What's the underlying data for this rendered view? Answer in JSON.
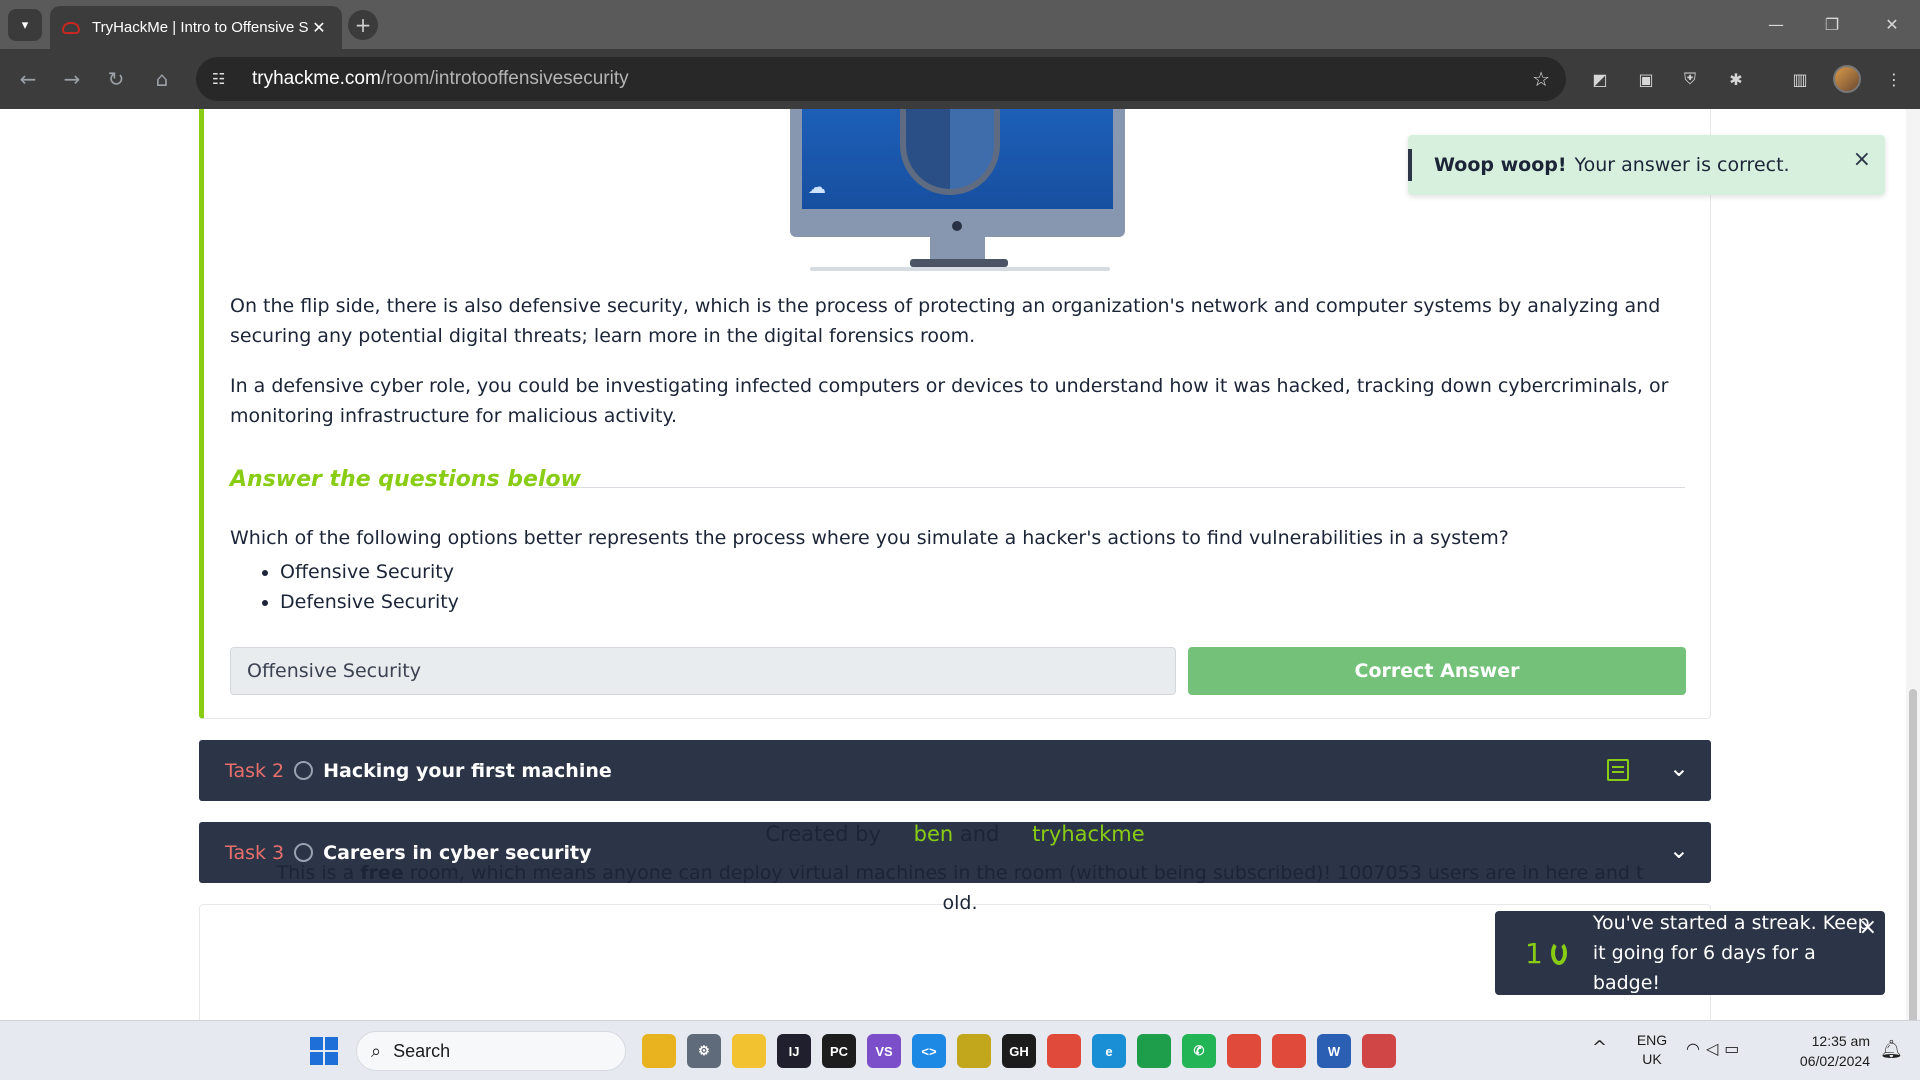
{
  "browser": {
    "tab_title": "TryHackMe | Intro to Offensive Security",
    "url_host": "tryhackme.com",
    "url_path": "/room/introtooffensivesecurity",
    "new_tab_symbol": "+",
    "tab_close_symbol": "✕"
  },
  "content": {
    "para1": "On the flip side, there is also defensive security, which is the process of protecting an organization's network and computer systems by analyzing and securing any potential digital threats; learn more in the digital forensics room.",
    "para2": "In a defensive cyber role, you could be investigating infected computers or devices to understand how it was hacked, tracking down cybercriminals, or monitoring infrastructure for malicious activity.",
    "answers_heading": "Answer the questions below",
    "question": "Which of the following options better represents the process where you simulate a hacker's actions to find vulnerabilities in a system?",
    "options": [
      "Offensive Security",
      "Defensive Security"
    ],
    "answer_value": "Offensive Security",
    "answer_button": "Correct Answer"
  },
  "tasks": [
    {
      "number": "Task 2",
      "title": "Hacking your first machine"
    },
    {
      "number": "Task 3",
      "title": "Careers in cyber security"
    }
  ],
  "footer": {
    "created_by": "Created by",
    "author1": "ben",
    "and": "and",
    "author2": "tryhackme",
    "free_prefix": "This is a ",
    "free_word": "free",
    "free_rest": " room, which means anyone can deploy virtual machines in the room (without being subscribed)! 1007053 users are in here and t",
    "free_tail": "old."
  },
  "toasts": {
    "success_bold": "Woop woop!",
    "success_text": "Your answer is correct.",
    "streak_count": "1",
    "streak_text": "You've started a streak. Keep it going for 6 days for a badge!"
  },
  "taskbar": {
    "search_label": "Search",
    "lang_line1": "ENG",
    "lang_line2": "UK",
    "time": "12:35 am",
    "date": "06/02/2024",
    "apps": [
      {
        "name": "copilot-icon",
        "label": "",
        "color": "#e9b320"
      },
      {
        "name": "settings-icon",
        "label": "⚙",
        "color": "#5f6b7a"
      },
      {
        "name": "file-explorer-icon",
        "label": "",
        "color": "#f2c230"
      },
      {
        "name": "intellij-icon",
        "label": "IJ",
        "color": "#1f1f2e"
      },
      {
        "name": "pycharm-icon",
        "label": "PC",
        "color": "#1d1d1d"
      },
      {
        "name": "visual-studio-icon",
        "label": "VS",
        "color": "#7b4fc9"
      },
      {
        "name": "vscode-icon",
        "label": "<>",
        "color": "#1e88e5"
      },
      {
        "name": "git-tool-icon",
        "label": "",
        "color": "#c2a61b"
      },
      {
        "name": "github-icon",
        "label": "GH",
        "color": "#1c1c1c"
      },
      {
        "name": "chrome-icon",
        "label": "",
        "color": "#e04a3a"
      },
      {
        "name": "edge-icon",
        "label": "e",
        "color": "#1a8fd6"
      },
      {
        "name": "classroom-icon",
        "label": "",
        "color": "#1e9e4a"
      },
      {
        "name": "whatsapp-icon",
        "label": "✆",
        "color": "#22b455"
      },
      {
        "name": "chrome-profile-icon",
        "label": "",
        "color": "#e04a3a"
      },
      {
        "name": "chrome-profile2-icon",
        "label": "",
        "color": "#e04a3a"
      },
      {
        "name": "word-icon",
        "label": "W",
        "color": "#2b5fb3"
      },
      {
        "name": "snipping-tool-icon",
        "label": "",
        "color": "#d04646"
      }
    ]
  },
  "colors": {
    "accent_green": "#88cc14",
    "task_bar_bg": "#2c3547",
    "task_number_red": "#e86f6b",
    "correct_button": "#74c27a",
    "success_toast_bg": "#d7f0de"
  }
}
